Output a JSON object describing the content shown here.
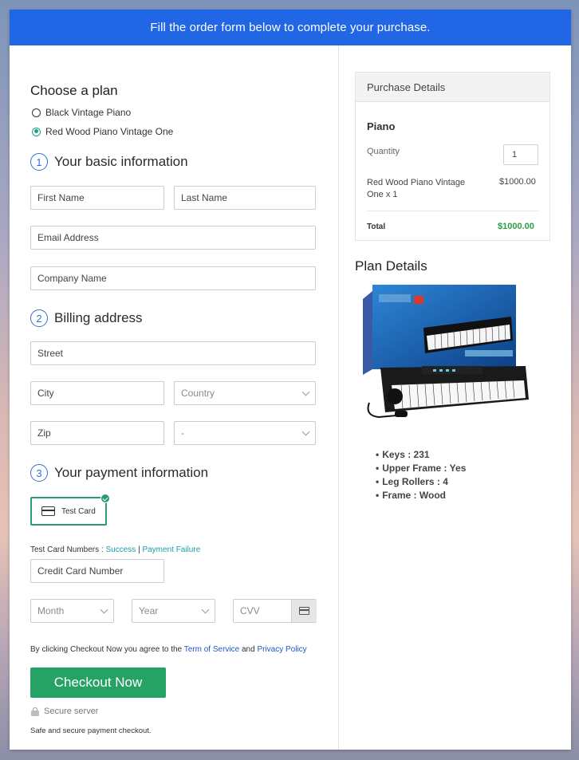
{
  "banner": {
    "text": "Fill the order form below to complete your purchase."
  },
  "plan": {
    "title": "Choose a plan",
    "options": [
      {
        "label": "Black Vintage Piano",
        "selected": false
      },
      {
        "label": "Red Wood Piano Vintage One",
        "selected": true
      }
    ]
  },
  "basic": {
    "number": "1",
    "title": "Your basic information",
    "first_name": "First Name",
    "last_name": "Last Name",
    "email": "Email Address",
    "company": "Company Name"
  },
  "billing": {
    "number": "2",
    "title": "Billing address",
    "street": "Street",
    "city": "City",
    "country": "Country",
    "zip": "Zip",
    "state": "-"
  },
  "payment": {
    "number": "3",
    "title": "Your payment information",
    "card_type": "Test Card",
    "test_numbers_label": "Test Card Numbers :",
    "success": "Success",
    "separator": "|",
    "failure": "Payment Failure",
    "card_number": "Credit Card Number",
    "month": "Month",
    "year": "Year",
    "cvv": "CVV"
  },
  "terms": {
    "prefix": "By clicking Checkout Now you agree to the",
    "tos": "Term of Service",
    "and": "and",
    "privacy": "Privacy Policy"
  },
  "checkout": {
    "button": "Checkout Now",
    "secure": "Secure server",
    "note": "Safe and secure payment checkout."
  },
  "purchase": {
    "header": "Purchase Details",
    "product": "Piano",
    "quantity_label": "Quantity",
    "quantity": "1",
    "line_item": "Red Wood Piano Vintage One x 1",
    "line_price": "$1000.00",
    "total_label": "Total",
    "total": "$1000.00"
  },
  "plan_details": {
    "title": "Plan Details",
    "features": [
      "Keys : 231",
      "Upper Frame : Yes",
      "Leg Rollers : 4",
      "Frame : Wood"
    ]
  },
  "colors": {
    "banner": "#2166e4",
    "accent_green": "#27a265",
    "link_teal": "#1a9fa8",
    "total_green": "#2a9b45"
  }
}
